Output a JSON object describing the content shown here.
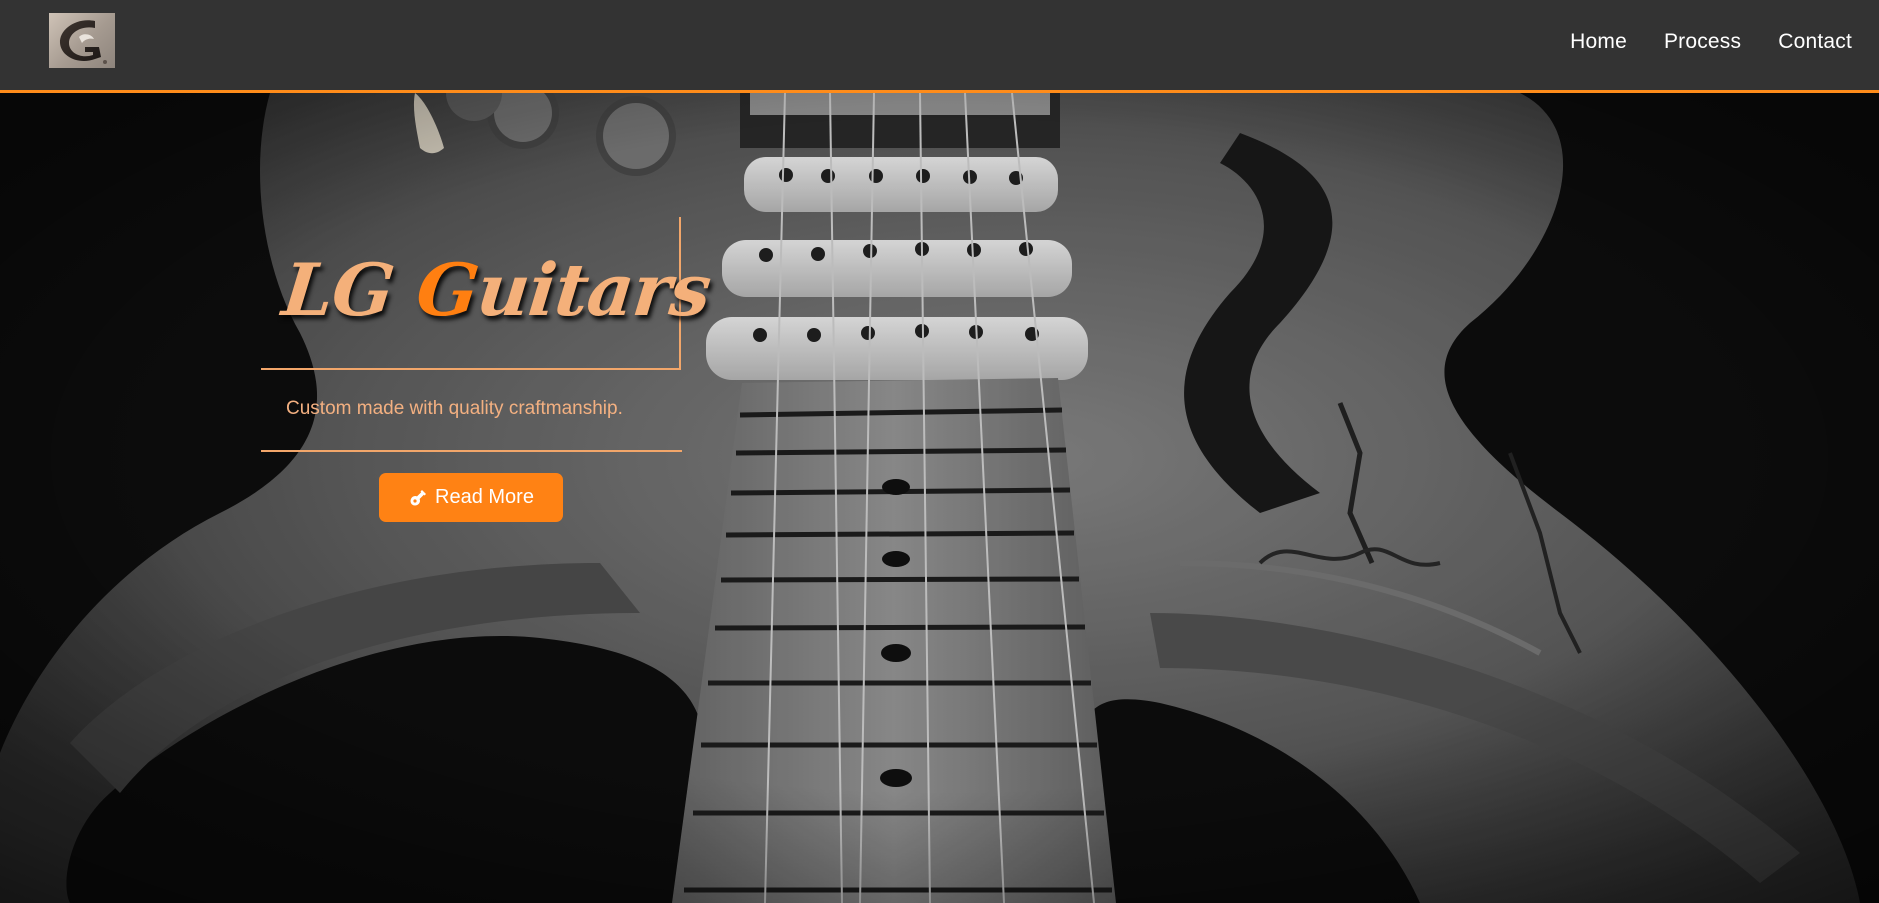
{
  "header": {
    "logo_alt": "LG",
    "nav": [
      {
        "label": "Home"
      },
      {
        "label": "Process"
      },
      {
        "label": "Contact"
      }
    ]
  },
  "hero": {
    "title_part1": "LG",
    "title_part2": "G",
    "title_part3": "uitars",
    "tagline": "Custom made with quality craftmanship.",
    "cta_label": "Read More",
    "cta_icon": "guitar-icon"
  },
  "colors": {
    "accent": "#ff8214",
    "title_light": "#f4b07a",
    "navbar_bg": "#333333"
  }
}
